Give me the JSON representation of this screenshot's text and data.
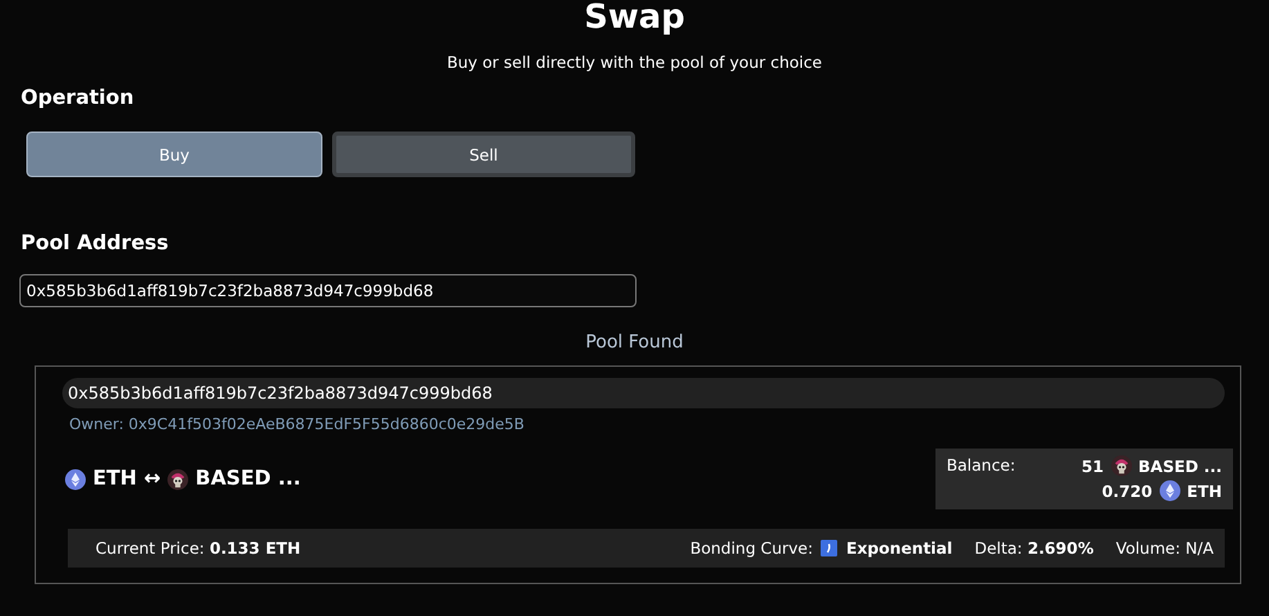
{
  "title": "Swap",
  "subtitle": "Buy or sell directly with the pool of your choice",
  "operation": {
    "label": "Operation",
    "options": [
      {
        "label": "Buy",
        "selected": true
      },
      {
        "label": "Sell",
        "selected": false
      }
    ]
  },
  "pool_address": {
    "label": "Pool Address",
    "value": "0x585b3b6d1aff819b7c23f2ba8873d947c999bd68"
  },
  "status": "Pool Found",
  "pool": {
    "address": "0x585b3b6d1aff819b7c23f2ba8873d947c999bd68",
    "owner": "Owner: 0x9C41f503f02eAeB6875EdF5F55d6860c0e29de5B",
    "pair": {
      "base": "ETH",
      "arrow": "↔",
      "token": "BASED ..."
    },
    "balance": {
      "label": "Balance:",
      "token_amount": "51",
      "token": "BASED ...",
      "eth_amount": "0.720",
      "eth": "ETH"
    },
    "stats": {
      "price_label": "Current Price:",
      "price": "0.133 ETH",
      "curve_label": "Bonding Curve:",
      "curve": "Exponential",
      "delta_label": "Delta:",
      "delta": "2.690%",
      "volume": "Volume: N/A"
    }
  }
}
